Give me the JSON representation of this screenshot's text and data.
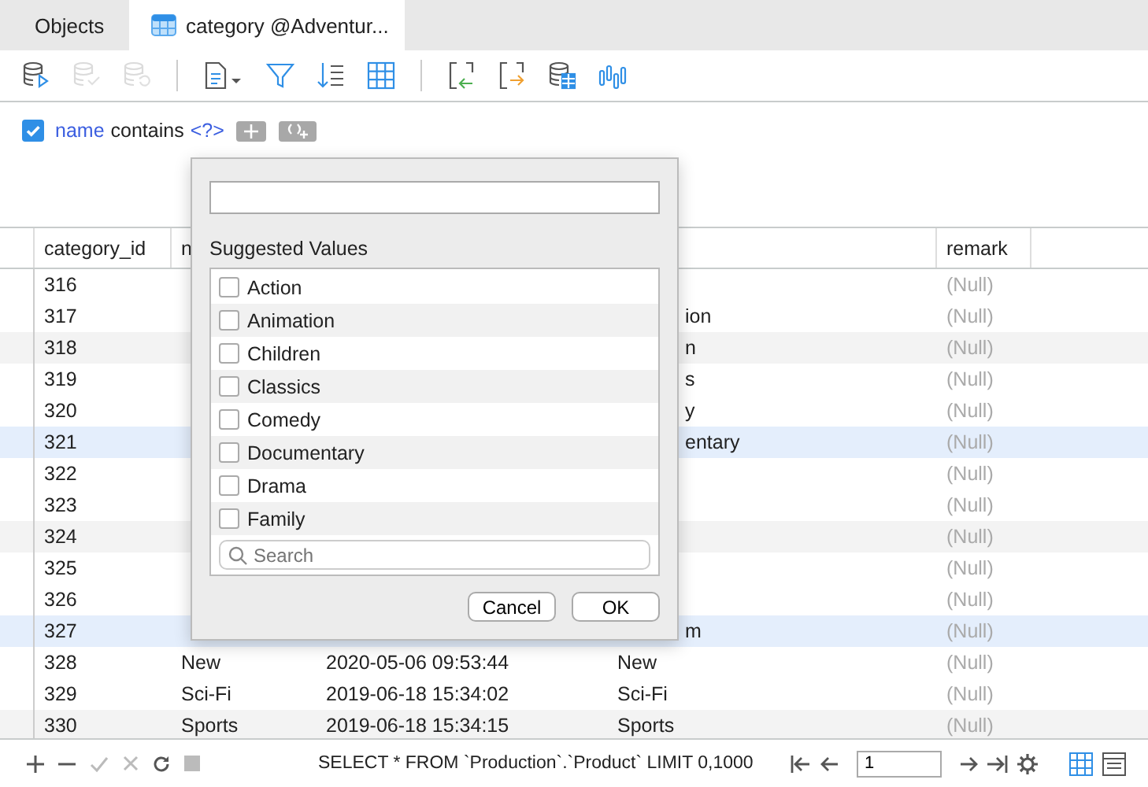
{
  "tabs": [
    {
      "label": "Objects",
      "selected": false,
      "kind": "plain"
    },
    {
      "label": "category @Adventur...",
      "selected": true,
      "kind": "table"
    }
  ],
  "toolbar": [
    {
      "kind": "db-run",
      "disabled": false
    },
    {
      "kind": "db-check",
      "disabled": true
    },
    {
      "kind": "db-undo",
      "disabled": true
    },
    {
      "kind": "sep"
    },
    {
      "kind": "doc",
      "disabled": false
    },
    {
      "kind": "filter",
      "disabled": false
    },
    {
      "kind": "sort",
      "disabled": false
    },
    {
      "kind": "grid",
      "disabled": false
    },
    {
      "kind": "sep"
    },
    {
      "kind": "import",
      "disabled": false
    },
    {
      "kind": "export",
      "disabled": false
    },
    {
      "kind": "db-table",
      "disabled": false
    },
    {
      "kind": "chart",
      "disabled": false
    }
  ],
  "filter": {
    "enabled": true,
    "field": "name",
    "operator": "contains",
    "value": "<?>"
  },
  "table": {
    "columns": [
      {
        "label": "category_id"
      },
      {
        "label": "n"
      },
      {
        "label": "remark"
      }
    ],
    "rows": [
      {
        "id": "316",
        "remark": "(Null)",
        "highlighted": false
      },
      {
        "id": "317",
        "title": "ion",
        "remark": "(Null)",
        "highlighted": false
      },
      {
        "id": "318",
        "title": "n",
        "remark": "(Null)",
        "highlighted": false
      },
      {
        "id": "319",
        "title": "s",
        "remark": "(Null)",
        "highlighted": false
      },
      {
        "id": "320",
        "title": "y",
        "remark": "(Null)",
        "highlighted": false
      },
      {
        "id": "321",
        "title": "entary",
        "remark": "(Null)",
        "highlighted": true
      },
      {
        "id": "322",
        "remark": "(Null)",
        "highlighted": false
      },
      {
        "id": "323",
        "remark": "(Null)",
        "highlighted": false
      },
      {
        "id": "324",
        "remark": "(Null)",
        "highlighted": false
      },
      {
        "id": "325",
        "remark": "(Null)",
        "highlighted": false
      },
      {
        "id": "326",
        "remark": "(Null)",
        "highlighted": false
      },
      {
        "id": "327",
        "title": "m",
        "remark": "(Null)",
        "highlighted": true
      },
      {
        "id": "328",
        "name": "New",
        "created": "2020-05-06 09:53:44",
        "title": "New",
        "remark": "(Null)",
        "highlighted": false
      },
      {
        "id": "329",
        "name": "Sci-Fi",
        "created": "2019-06-18 15:34:02",
        "title": "Sci-Fi",
        "remark": "(Null)",
        "highlighted": false
      },
      {
        "id": "330",
        "name": "Sports",
        "created": "2019-06-18 15:34:15",
        "title": "Sports",
        "remark": "(Null)",
        "highlighted": false
      }
    ]
  },
  "popup": {
    "heading": "Suggested Values",
    "values": [
      {
        "label": "Action",
        "checked": false
      },
      {
        "label": "Animation",
        "checked": false
      },
      {
        "label": "Children",
        "checked": false
      },
      {
        "label": "Classics",
        "checked": false
      },
      {
        "label": "Comedy",
        "checked": false
      },
      {
        "label": "Documentary",
        "checked": false
      },
      {
        "label": "Drama",
        "checked": false
      },
      {
        "label": "Family",
        "checked": false
      }
    ],
    "search": {
      "placeholder": "Search"
    },
    "buttons": [
      "Cancel",
      "OK"
    ]
  },
  "status_bar": {
    "query": "SELECT * FROM `Production`.`Product` LIMIT 0,1000",
    "page": "1",
    "views": [
      {
        "kind": "grid",
        "selected": true
      },
      {
        "kind": "form",
        "selected": false
      }
    ]
  }
}
